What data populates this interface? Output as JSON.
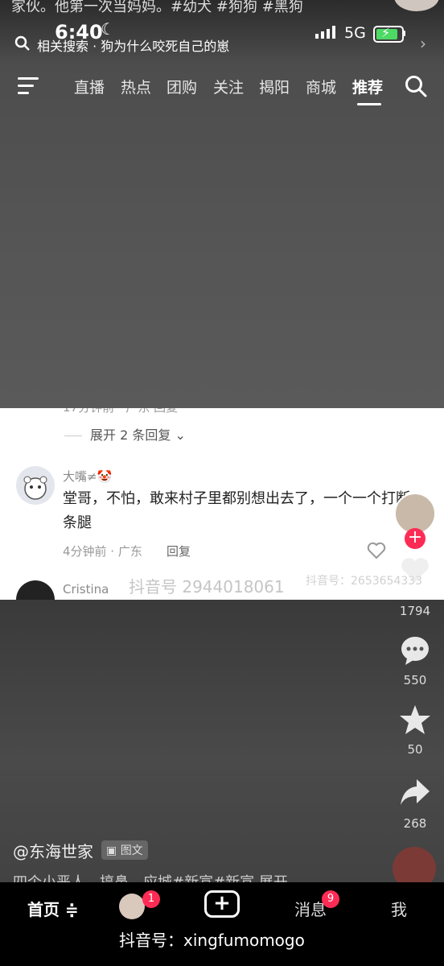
{
  "ghost_caption": "家伙。他第一次当妈妈。#幼犬 #狗狗 #黑狗",
  "status": {
    "time": "6:40",
    "network": "5G"
  },
  "search": {
    "prefix": "相关搜索 ·",
    "query": "狗为什么咬死自己的崽"
  },
  "tabs": [
    "直播",
    "热点",
    "团购",
    "关注",
    "揭阳",
    "商城",
    "推荐"
  ],
  "active_tab": "推荐",
  "comments": {
    "expand_label": "展开 2 条回复",
    "items": [
      {
        "user": "大嘴≠🤡",
        "text": "堂哥，不怕，敢来村子里都别想出去了，一个一个打断一条腿",
        "time_location": "4分钟前 · 广东",
        "reply_label": "回复"
      },
      {
        "user": "Cristina"
      }
    ],
    "watermark_main": "抖音号 2944018061",
    "watermark_side": "抖音号：2653654333"
  },
  "rail": {
    "likes": "1794",
    "comments": "550",
    "favorites": "50",
    "shares": "268"
  },
  "post": {
    "author": "@东海世家",
    "type_badge": "图文",
    "caption_cut": "四个小恶人，搞鼻，应城#新宣#新宣 展开"
  },
  "bottom_nav": {
    "home": "首页",
    "friends_badge": "1",
    "messages": "消息",
    "messages_badge": "9",
    "me": "我",
    "watermark": "抖音号：xingfumomogo"
  },
  "colors": {
    "accent": "#fe2c55",
    "battery": "#4cd964"
  }
}
